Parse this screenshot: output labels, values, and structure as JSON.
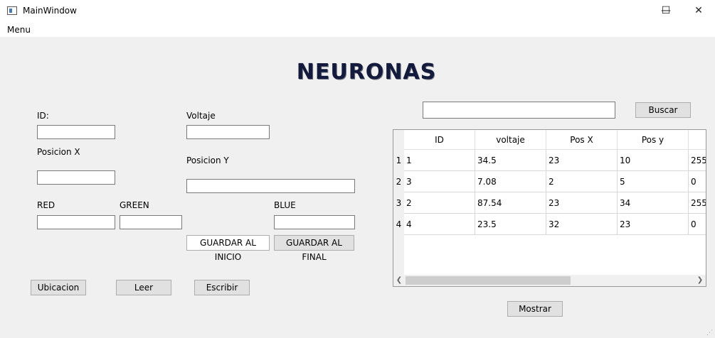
{
  "window": {
    "title": "MainWindow",
    "minimize_glyph": "—",
    "maximize_glyph": "☐",
    "close_glyph": "✕"
  },
  "menubar": {
    "menu_label": "Menu"
  },
  "heading": "NEURONAS",
  "form": {
    "id_label": "ID:",
    "voltaje_label": "Voltaje",
    "posx_label": "Posicion X",
    "posy_label": "Posicion Y",
    "red_label": "RED",
    "green_label": "GREEN",
    "blue_label": "BLUE",
    "id_value": "",
    "voltaje_value": "",
    "posx_value": "",
    "posy_value": "",
    "red_value": "",
    "green_value": "",
    "blue_value": ""
  },
  "buttons": {
    "guardar_inicio": "GUARDAR AL INICIO",
    "guardar_final": "GUARDAR AL FINAL",
    "ubicacion": "Ubicacion",
    "leer": "Leer",
    "escribir": "Escribir",
    "buscar": "Buscar",
    "mostrar": "Mostrar"
  },
  "search": {
    "value": ""
  },
  "table": {
    "headers": [
      "ID",
      "voltaje",
      "Pos X",
      "Pos y"
    ],
    "row_headers": [
      "1",
      "2",
      "3",
      "4"
    ],
    "rows": [
      [
        "1",
        "34.5",
        "23",
        "10",
        "255"
      ],
      [
        "3",
        "7.08",
        "2",
        "5",
        "0"
      ],
      [
        "2",
        "87.54",
        "23",
        "34",
        "255"
      ],
      [
        "4",
        "23.5",
        "32",
        "23",
        "0"
      ]
    ]
  },
  "icons": {
    "app": "window-icon",
    "scroll_left": "chevron-left-icon",
    "scroll_right": "chevron-right-icon",
    "resize": "size-grip-icon"
  }
}
